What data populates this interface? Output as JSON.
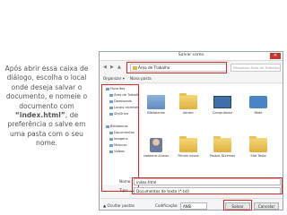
{
  "instruction": {
    "before": "Após abrir essa caixa de diálogo, escolha o local onde deseja salvar o documento, e nomeie o documento com ",
    "filename": "“index.html”",
    "after": ", de preferência o salve em uma pasta com o seu nome."
  },
  "dialog": {
    "title": "Salvar como",
    "close_label": "✕",
    "address": "Área de Trabalho",
    "search_placeholder": "Pesquisar Área de Trabalho",
    "toolbar": {
      "organize": "Organizar ▾",
      "new_folder": "Nova pasta"
    },
    "nav_items": [
      {
        "label": "Favoritos"
      },
      {
        "label": "Área de Trabalho"
      },
      {
        "label": "Downloads"
      },
      {
        "label": "Locais recentes"
      },
      {
        "label": "SkyDrive"
      },
      {
        "label": "Bibliotecas"
      },
      {
        "label": "Documentos"
      },
      {
        "label": "Imagens"
      },
      {
        "label": "Músicas"
      },
      {
        "label": "Vídeos"
      }
    ],
    "items": [
      {
        "label": "Bibliotecas",
        "icon": "library-icon"
      },
      {
        "label": "deuter",
        "icon": "user-folder-icon"
      },
      {
        "label": "Computador",
        "icon": "computer-icon"
      },
      {
        "label": "Rede",
        "icon": "network-icon"
      },
      {
        "label": "cadastro alunos",
        "icon": "person-icon"
      },
      {
        "label": "Filmes novos",
        "icon": "folder-icon"
      },
      {
        "label": "Pastas Diversas",
        "icon": "folder-icon"
      },
      {
        "label": "Site Teste",
        "icon": "folder-icon"
      }
    ],
    "name_label": "Nome:",
    "name_value": "index.html",
    "type_label": "Tipo:",
    "type_value": "Documentos de texto (*.txt)",
    "hide_folders": "▲ Ocultar pastas",
    "encoding_label": "Codificação:",
    "encoding_value": "ANSI",
    "save": "Salvar",
    "cancel": "Cancelar"
  },
  "colors": {
    "highlight": "#d42a2a"
  }
}
